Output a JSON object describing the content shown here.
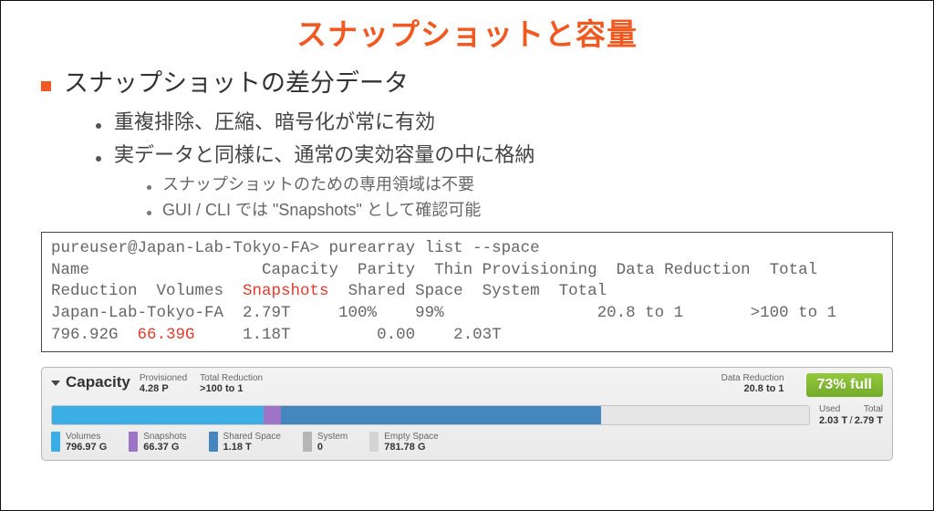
{
  "title": "スナップショットと容量",
  "bullets": {
    "l1": "スナップショットの差分データ",
    "l2a": "重複排除、圧縮、暗号化が常に有効",
    "l2b": "実データと同様に、通常の実効容量の中に格納",
    "l3a": "スナップショットのための専用領域は不要",
    "l3b": "GUI / CLI では \"Snapshots\" として確認可能"
  },
  "cli": {
    "prompt": "pureuser@Japan-Lab-Tokyo-FA> purearray list --space",
    "hdr1": "Name                  Capacity  Parity  Thin Provisioning  Data Reduction  Total",
    "hdr2_a": "Reduction  Volumes  ",
    "hdr2_snap": "Snapshots",
    "hdr2_b": "  Shared Space  System  Total",
    "row1": "Japan-Lab-Tokyo-FA  2.79T     100%    99%                20.8 to 1       >100 to 1",
    "row2_a": "796.92G  ",
    "row2_snapval": "66.39G",
    "row2_b": "     1.18T         0.00    2.03T"
  },
  "capacity": {
    "title": "Capacity",
    "provisioned_label": "Provisioned",
    "provisioned_value": "4.28 P",
    "totalred_label": "Total Reduction",
    "totalred_value": ">100 to 1",
    "datared_label": "Data Reduction",
    "datared_value": "20.8 to 1",
    "full_badge": "73% full",
    "used_label": "Used",
    "total_label": "Total",
    "used_value": "2.03 T",
    "total_value": "2.79 T",
    "legend": {
      "volumes_label": "Volumes",
      "volumes_value": "796.97 G",
      "snaps_label": "Snapshots",
      "snaps_value": "66.37 G",
      "shared_label": "Shared Space",
      "shared_value": "1.18 T",
      "system_label": "System",
      "system_value": "0",
      "empty_label": "Empty Space",
      "empty_value": "781.78 G"
    }
  },
  "chart_data": {
    "type": "bar",
    "title": "Capacity Usage",
    "total": {
      "value": 2.79,
      "unit": "T"
    },
    "used": {
      "value": 2.03,
      "unit": "T"
    },
    "full_percent": 73,
    "segments": [
      {
        "name": "Volumes",
        "value": 796.97,
        "unit": "G",
        "percent": 27.9
      },
      {
        "name": "Snapshots",
        "value": 66.37,
        "unit": "G",
        "percent": 2.3
      },
      {
        "name": "Shared Space",
        "value": 1.18,
        "unit": "T",
        "percent": 42.3
      },
      {
        "name": "System",
        "value": 0,
        "unit": "G",
        "percent": 0
      },
      {
        "name": "Empty Space",
        "value": 781.78,
        "unit": "G",
        "percent": 27.5
      }
    ]
  }
}
